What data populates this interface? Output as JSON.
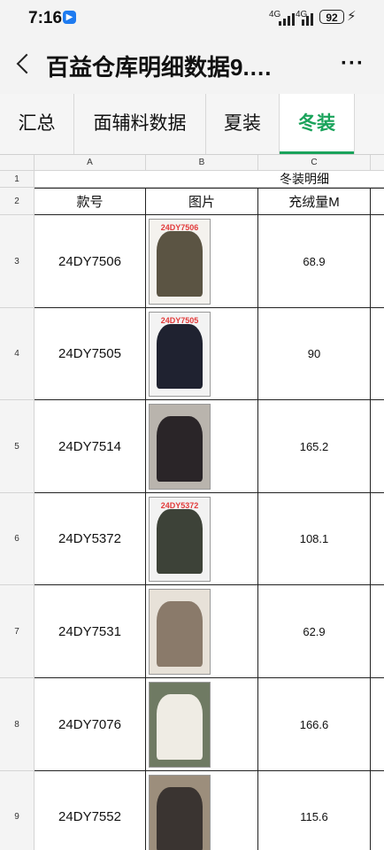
{
  "status": {
    "time": "7:16",
    "net1": "4G",
    "net2": "4G",
    "battery": "92"
  },
  "header": {
    "title": "百益仓库明细数据9.…"
  },
  "tabs": [
    {
      "label": "汇总"
    },
    {
      "label": "面辅料数据"
    },
    {
      "label": "夏装"
    },
    {
      "label": "冬装",
      "active": true
    }
  ],
  "sheet": {
    "col_headers": [
      "A",
      "B",
      "C"
    ],
    "row1": {
      "num": "1",
      "merged_title": "冬装明细"
    },
    "row2": {
      "num": "2",
      "a": "款号",
      "b": "图片",
      "c": "充绒量M"
    },
    "rows": [
      {
        "num": "3",
        "style_no": "24DY7506",
        "fill": "68.9",
        "photo_label": "24DY7506",
        "photo_color": "#5b5443",
        "bg": "#f4f2ee"
      },
      {
        "num": "4",
        "style_no": "24DY7505",
        "fill": "90",
        "photo_label": "24DY7505",
        "photo_color": "#1f2230",
        "bg": "#f3f3f3"
      },
      {
        "num": "5",
        "style_no": "24DY7514",
        "fill": "165.2",
        "photo_label": "",
        "photo_color": "#2a2528",
        "bg": "#b9b4ad"
      },
      {
        "num": "6",
        "style_no": "24DY5372",
        "fill": "108.1",
        "photo_label": "24DY5372",
        "photo_color": "#3d4238",
        "bg": "#f2f2f2"
      },
      {
        "num": "7",
        "style_no": "24DY7531",
        "fill": "62.9",
        "photo_label": "",
        "photo_color": "#8a7a6a",
        "bg": "#e7e1d8"
      },
      {
        "num": "8",
        "style_no": "24DY7076",
        "fill": "166.6",
        "photo_label": "",
        "photo_color": "#efece4",
        "bg": "#6f7a63"
      },
      {
        "num": "9",
        "style_no": "24DY7552",
        "fill": "115.6",
        "photo_label": "",
        "photo_color": "#3a3431",
        "bg": "#9c8e7c"
      }
    ]
  }
}
